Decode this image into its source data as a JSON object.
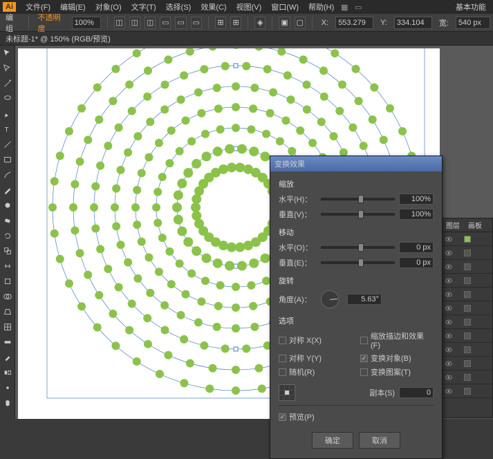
{
  "menubar": {
    "logo": "Ai",
    "items": [
      "文件(F)",
      "编辑(E)",
      "对象(O)",
      "文字(T)",
      "选择(S)",
      "效果(C)",
      "视图(V)",
      "窗口(W)",
      "帮助(H)"
    ],
    "right": "基本功能"
  },
  "toolbar": {
    "label": "编组",
    "opacity_label": "不透明度",
    "opacity": "100%",
    "x": "553.279",
    "y": "334.104",
    "w": "540 px"
  },
  "tab": {
    "title": "未标题-1* @ 150% (RGB/预览)"
  },
  "panel": {
    "tabs": [
      "图层",
      "画板"
    ]
  },
  "dialog": {
    "title": "变换效果",
    "scale": {
      "label": "缩放",
      "h_label": "水平(H)：",
      "h": "100%",
      "v_label": "垂直(V)：",
      "v": "100%"
    },
    "move": {
      "label": "移动",
      "h_label": "水平(O)：",
      "h": "0 px",
      "v_label": "垂直(E)：",
      "v": "0 px"
    },
    "rotate": {
      "label": "旋转",
      "angle_label": "角度(A)：",
      "angle": "5.63°"
    },
    "options": {
      "label": "选项",
      "reflect_x": "对称 X(X)",
      "scale_strokes": "缩放描边和效果(F)",
      "reflect_y": "对称 Y(Y)",
      "transform_objects": "变换对象(B)",
      "random": "随机(R)",
      "transform_patterns": "变换图案(T)"
    },
    "copies": {
      "label": "副本(S)",
      "value": "0"
    },
    "preview": "预览(P)",
    "ok": "确定",
    "cancel": "取消"
  }
}
